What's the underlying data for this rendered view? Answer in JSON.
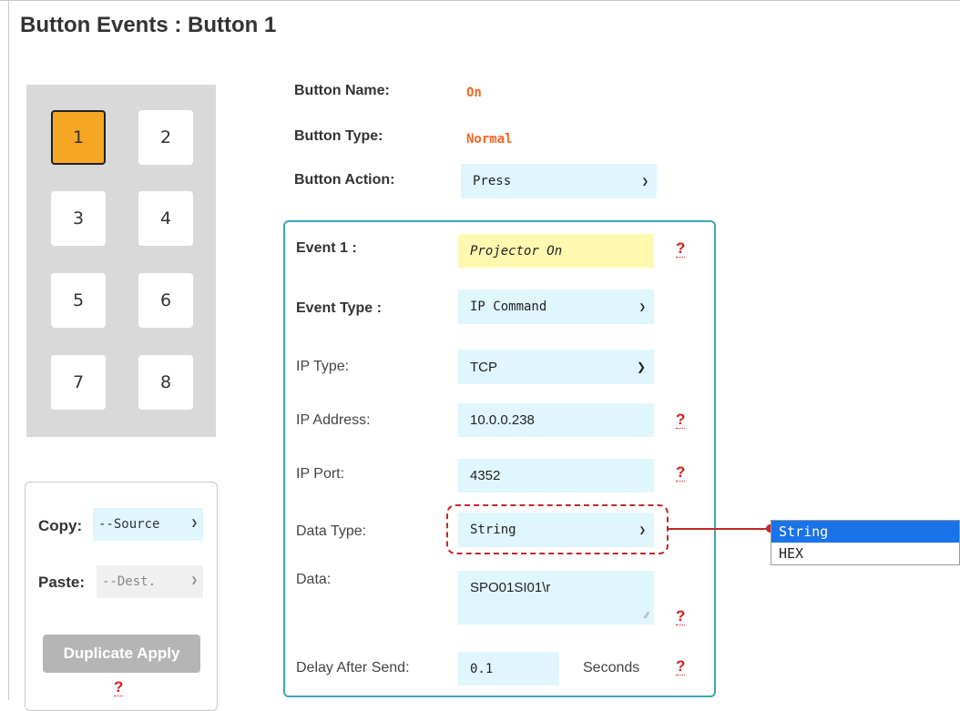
{
  "page": {
    "title": "Button Events : Button 1"
  },
  "button_grid": [
    {
      "label": "1",
      "active": true
    },
    {
      "label": "2",
      "active": false
    },
    {
      "label": "3",
      "active": false
    },
    {
      "label": "4",
      "active": false
    },
    {
      "label": "5",
      "active": false
    },
    {
      "label": "6",
      "active": false
    },
    {
      "label": "7",
      "active": false
    },
    {
      "label": "8",
      "active": false
    }
  ],
  "copy_panel": {
    "copy_label": "Copy:",
    "copy_value": "--Source",
    "paste_label": "Paste:",
    "paste_value": "--Dest.",
    "duplicate_label": "Duplicate Apply",
    "help": "?"
  },
  "button": {
    "name_label": "Button Name:",
    "name_value": "On",
    "type_label": "Button Type:",
    "type_value": "Normal",
    "action_label": "Button Action:",
    "action_value": "Press"
  },
  "event": {
    "event_label": "Event 1 :",
    "event_value": "Projector On",
    "event_type_label": "Event Type :",
    "event_type_value": "IP Command",
    "ip_type_label": "IP Type:",
    "ip_type_value": "TCP",
    "ip_address_label": "IP Address:",
    "ip_address_value": "10.0.0.238",
    "ip_port_label": "IP Port:",
    "ip_port_value": "4352",
    "data_type_label": "Data Type:",
    "data_type_value": "String",
    "data_label": "Data:",
    "data_value": "SPO01SI01\\r",
    "delay_label": "Delay After Send:",
    "delay_value": "0.1",
    "seconds_label": "Seconds",
    "help": "?"
  },
  "data_type_dropdown": {
    "options": [
      "String",
      "HEX"
    ],
    "selected": "String"
  },
  "colors": {
    "active_button": "#f5a623",
    "field_bg": "#e0f6fd",
    "highlight_field": "#fff9b0",
    "value_orange": "#f26522",
    "event_border": "#3aa6b9",
    "annotation_red": "#c0272d",
    "selected_option": "#1a73e8"
  },
  "icons": {
    "select_arrow": "chevron-down-icon",
    "help": "question-mark-icon"
  }
}
